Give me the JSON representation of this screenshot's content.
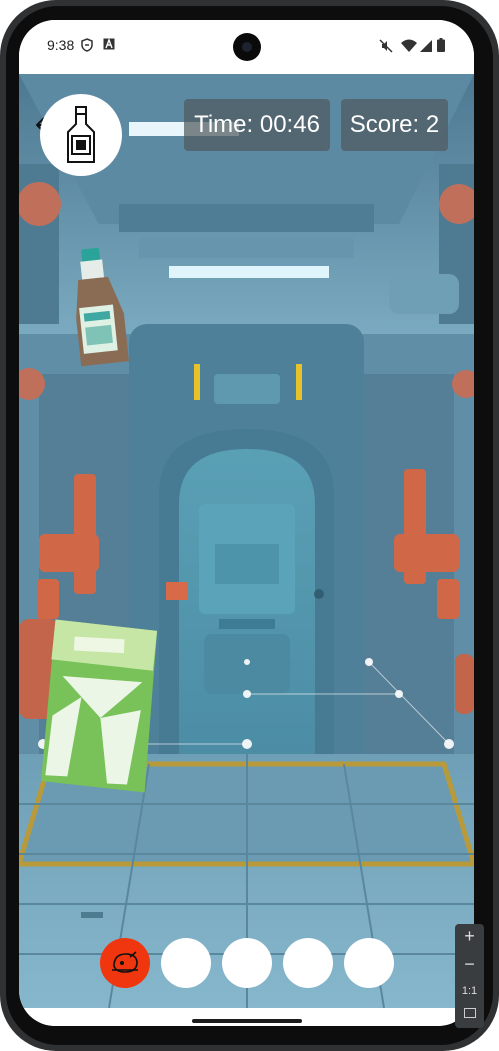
{
  "status": {
    "time": "9:38",
    "left_icons": [
      "shield-icon",
      "a-icon"
    ],
    "right_icons": [
      "mute-icon",
      "wifi-icon",
      "signal-icon",
      "battery-icon"
    ]
  },
  "hud": {
    "timer": "Time: 00:46",
    "score": "Score: 2",
    "target_item": "bottle-icon"
  },
  "scene": {
    "items": [
      "sauce-bottle",
      "chip-bag"
    ]
  },
  "inventory": {
    "slots": [
      {
        "state": "filled",
        "icon": "roast-chicken-icon",
        "color": "#f0360e"
      },
      {
        "state": "empty"
      },
      {
        "state": "empty"
      },
      {
        "state": "empty"
      },
      {
        "state": "empty"
      }
    ]
  },
  "emulator_controls": {
    "zoom_in": "+",
    "zoom_out": "−",
    "ratio": "1:1"
  }
}
